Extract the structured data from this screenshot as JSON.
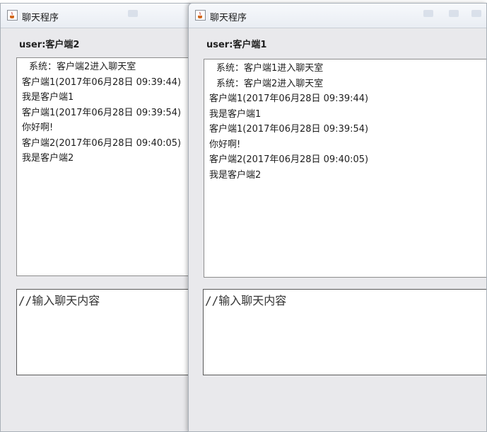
{
  "windows": [
    {
      "title": "聊天程序",
      "user_label": "user:客户端2",
      "messages": [
        "系统：客户端2进入聊天室",
        "客户端1(2017年06月28日 09:39:44)",
        "我是客户端1",
        "客户端1(2017年06月28日 09:39:54)",
        "你好啊!",
        "客户端2(2017年06月28日 09:40:05)",
        "我是客户端2"
      ],
      "input_text": "//输入聊天内容"
    },
    {
      "title": "聊天程序",
      "user_label": "user:客户端1",
      "messages": [
        "系统：客户端1进入聊天室",
        "系统：客户端2进入聊天室",
        "客户端1(2017年06月28日 09:39:44)",
        "我是客户端1",
        "客户端1(2017年06月28日 09:39:54)",
        "你好啊!",
        "客户端2(2017年06月28日 09:40:05)",
        "我是客户端2"
      ],
      "input_text": "//输入聊天内容"
    }
  ],
  "icons": {
    "app": "java-coffee-icon"
  },
  "colors": {
    "window_bg": "#e9e9ec",
    "border": "#8d8d8d"
  }
}
